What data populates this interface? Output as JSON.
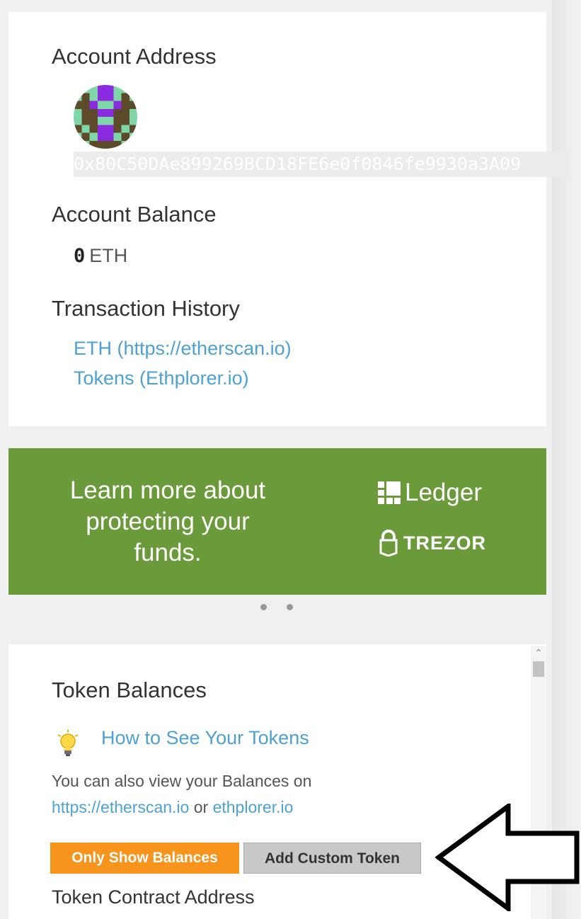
{
  "account": {
    "address_heading": "Account Address",
    "address": "0x80C50DAe899269BCD18FE6e0f0846fe9930a3A09",
    "balance_heading": "Account Balance",
    "balance_value": "0",
    "balance_unit": "ETH",
    "history_heading": "Transaction History",
    "history_links": [
      "ETH (https://etherscan.io)",
      "Tokens (Ethplorer.io)"
    ]
  },
  "banner": {
    "text": "Learn more about protecting your funds.",
    "brands": [
      "Ledger",
      "TREZOR"
    ],
    "background_color": "#6a9a3a"
  },
  "carousel": {
    "dot_count": 2
  },
  "tokens": {
    "heading": "Token Balances",
    "howto_link": "How to See Your Tokens",
    "info_line1": "You can also view your Balances on",
    "link_etherscan": "https://etherscan.io",
    "or": "or",
    "link_ethplorer": "ethplorer.io",
    "btn_only_balances": "Only Show Balances",
    "btn_add_custom": "Add Custom Token",
    "contract_label": "Token Contract Address"
  },
  "colors": {
    "accent_orange": "#f7941d",
    "link_blue": "#4ea1d3"
  },
  "icons": [
    "identicon-avatar",
    "lightbulb-icon",
    "ledger-icon",
    "trezor-lock-icon",
    "arrow-pointer-icon"
  ]
}
